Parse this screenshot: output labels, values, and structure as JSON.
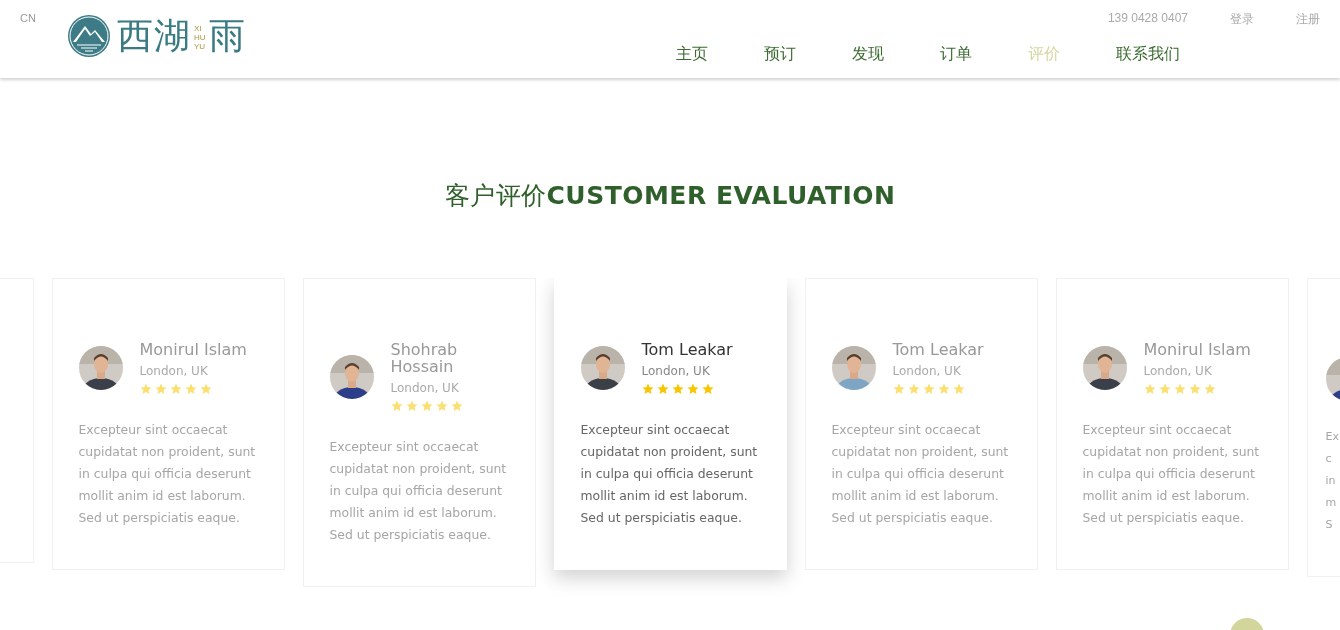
{
  "header": {
    "language": "CN",
    "logo": {
      "name": "西湖",
      "name_end": "雨",
      "pinyin": [
        "XI",
        "HU",
        "YU"
      ]
    },
    "phone": "139 0428 0407",
    "account_links": [
      "登录",
      "注册"
    ],
    "nav": [
      {
        "label": "主页",
        "selected": false
      },
      {
        "label": "预订",
        "selected": false
      },
      {
        "label": "发现",
        "selected": false
      },
      {
        "label": "订单",
        "selected": false
      },
      {
        "label": "评价",
        "selected": true
      },
      {
        "label": "联系我们",
        "selected": false
      }
    ]
  },
  "section": {
    "title": "客户评价**CUSTOMER EVALUATION**"
  },
  "reviews": [
    {
      "kind": "edge"
    },
    {
      "kind": "full",
      "selected": false,
      "name": "Monirul Islam",
      "location": "London, UK",
      "stars": 5,
      "text": "Excepteur sint occaecat cupidatat non proident, sunt in culpa qui officia deserunt mollit anim id est laborum. Sed ut perspiciatis eaque.",
      "photo": {
        "kind": "picture"
      }
    },
    {
      "kind": "full",
      "selected": false,
      "name": "Shohrab Hossain",
      "location": "London, UK",
      "stars": 5,
      "text": "Excepteur sint occaecat cupidatat non proident, sunt in culpa qui officia deserunt mollit anim id est laborum. Sed ut perspiciatis eaque.",
      "photo": {
        "kind": "picture"
      }
    },
    {
      "kind": "full",
      "selected": true,
      "name": "Tom Leakar",
      "location": "London, UK",
      "stars": 5,
      "text": "Excepteur sint occaecat cupidatat non proident, sunt in culpa qui officia deserunt mollit anim id est laborum. Sed ut perspiciatis eaque.",
      "photo": {
        "kind": "picture"
      }
    },
    {
      "kind": "full",
      "selected": false,
      "name": "Tom Leakar",
      "location": "London, UK",
      "stars": 5,
      "text": "Excepteur sint occaecat cupidatat non proident, sunt in culpa qui officia deserunt mollit anim id est laborum. Sed ut perspiciatis eaque.",
      "photo": {
        "kind": "picture"
      }
    },
    {
      "kind": "full",
      "selected": false,
      "name": "Monirul Islam",
      "location": "London, UK",
      "stars": 5,
      "text": "Excepteur sint occaecat cupidatat non proident, sunt in culpa qui officia deserunt mollit anim id est laborum. Sed ut perspiciatis eaque.",
      "photo": {
        "kind": "picture"
      }
    },
    {
      "kind": "edge",
      "text_lines": [
        "Ex",
        "c",
        "in",
        "m",
        "S"
      ],
      "photo": {
        "kind": "picture"
      }
    }
  ]
}
